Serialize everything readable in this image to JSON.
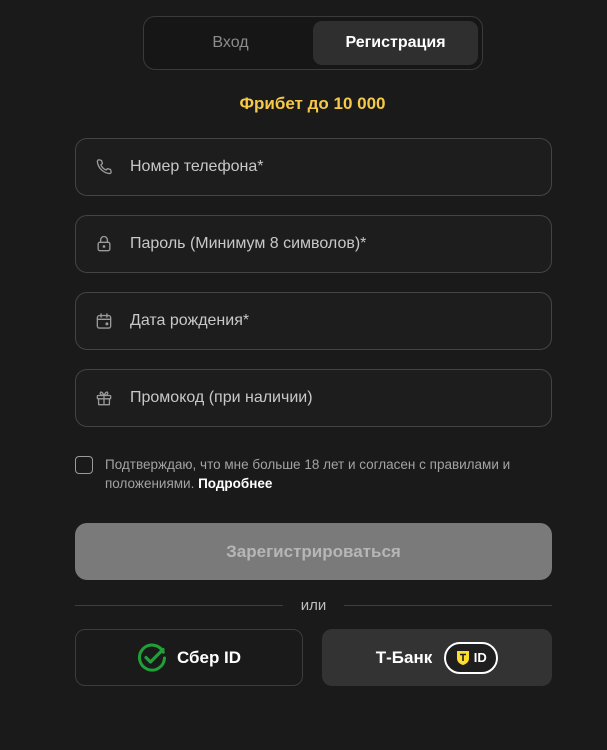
{
  "tabs": {
    "login_label": "Вход",
    "register_label": "Регистрация"
  },
  "promo": {
    "title": "Фрибет до 10 000"
  },
  "fields": {
    "phone": {
      "placeholder": "Номер телефона*",
      "icon": "phone-icon"
    },
    "password": {
      "placeholder": "Пароль (Минимум 8 символов)*",
      "icon": "lock-icon"
    },
    "birthdate": {
      "placeholder": "Дата рождения*",
      "icon": "calendar-icon"
    },
    "promocode": {
      "placeholder": "Промокод (при наличии)",
      "icon": "gift-icon"
    }
  },
  "consent": {
    "text": "Подтверждаю, что мне больше 18 лет и согласен с правилами и положениями.",
    "more_label": "Подробнее"
  },
  "submit": {
    "label": "Зарегистрироваться"
  },
  "divider": {
    "label": "или"
  },
  "sso": {
    "sber_label": "Сбер ID",
    "tbank_label": "Т-Банк",
    "tbank_badge": "ID"
  },
  "colors": {
    "background": "#1a1a1a",
    "accent": "#f7c948",
    "sber_green": "#21a038",
    "tbank_yellow": "#ffdd2d",
    "submit_disabled": "#7a7a7a"
  }
}
